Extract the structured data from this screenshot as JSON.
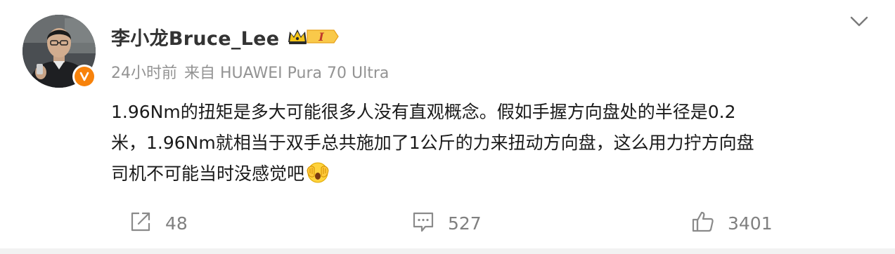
{
  "post": {
    "author": {
      "name": "李小龙Bruce_Lee",
      "avatar_icon": "user-avatar-photo",
      "verified_icon": "verified-v-badge-icon",
      "verified_color": "#f7820b",
      "member_badge_icon": "crown-member-badge-icon",
      "member_level": "I"
    },
    "meta": {
      "time": "24小时前",
      "source_prefix": "来自",
      "source": "HUAWEI Pura 70 Ultra"
    },
    "menu_icon": "chevron-down-icon",
    "content": {
      "lines": [
        "1.96Nm的扭矩是多大可能很多人没有直观概念。假如手握方向盘处的半径是0.2",
        "米，1.96Nm就相当于双手总共施加了1公斤的力来扭动方向盘，这么用力拧方向盘",
        "司机不可能当时没感觉吧"
      ],
      "trailing_emoji": "shocked-face-emoji"
    },
    "actions": {
      "repost": {
        "icon": "share-icon",
        "count": "48"
      },
      "comment": {
        "icon": "comment-icon",
        "count": "527"
      },
      "like": {
        "icon": "thumbs-up-icon",
        "count": "3401"
      }
    }
  }
}
